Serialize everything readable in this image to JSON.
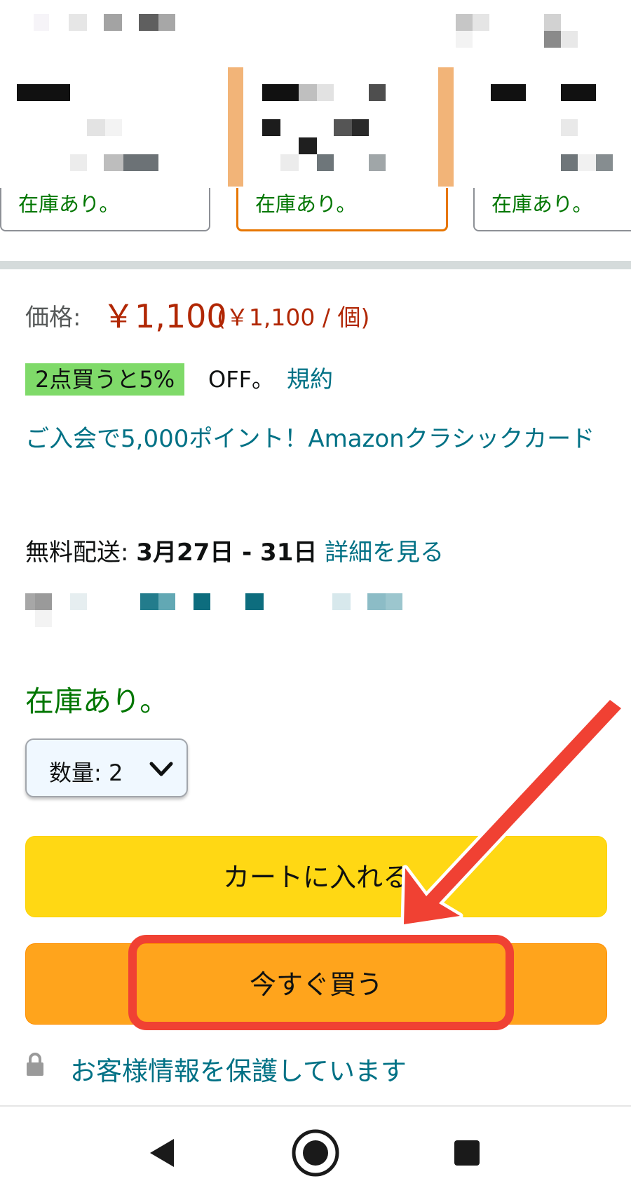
{
  "variants": [
    {
      "stock": "在庫あり。",
      "selected": false
    },
    {
      "stock": "在庫あり。",
      "selected": true
    },
    {
      "stock": "在庫あり。",
      "selected": false
    }
  ],
  "price": {
    "label": "価格:",
    "amount": "￥1,100",
    "unit_price": "(￥1,100 / 個)"
  },
  "promotion": {
    "badge": "2点買うと5%",
    "suffix": "OFF。",
    "terms_link": "規約"
  },
  "card_offer": "ご入会で5,000ポイント！Amazonクラシックカード",
  "delivery": {
    "label": "無料配送:",
    "dates": "3月27日 - 31日",
    "details_link": "詳細を見る"
  },
  "availability": "在庫あり。",
  "quantity": {
    "label": "数量:",
    "value": "2"
  },
  "buttons": {
    "add_to_cart": "カートに入れる",
    "buy_now": "今すぐ買う"
  },
  "secure_transaction": "お客様情報を保護しています",
  "colors": {
    "price": "#b12704",
    "link": "#007185",
    "in_stock": "#007600",
    "cart_button": "#ffd814",
    "buy_button": "#ffa41c",
    "annotation": "#f04133"
  },
  "icons": {
    "lock": "lock-icon",
    "chevron": "chevron-down-icon",
    "nav_back": "back-triangle-icon",
    "nav_home": "home-circle-icon",
    "nav_recents": "recents-square-icon"
  }
}
